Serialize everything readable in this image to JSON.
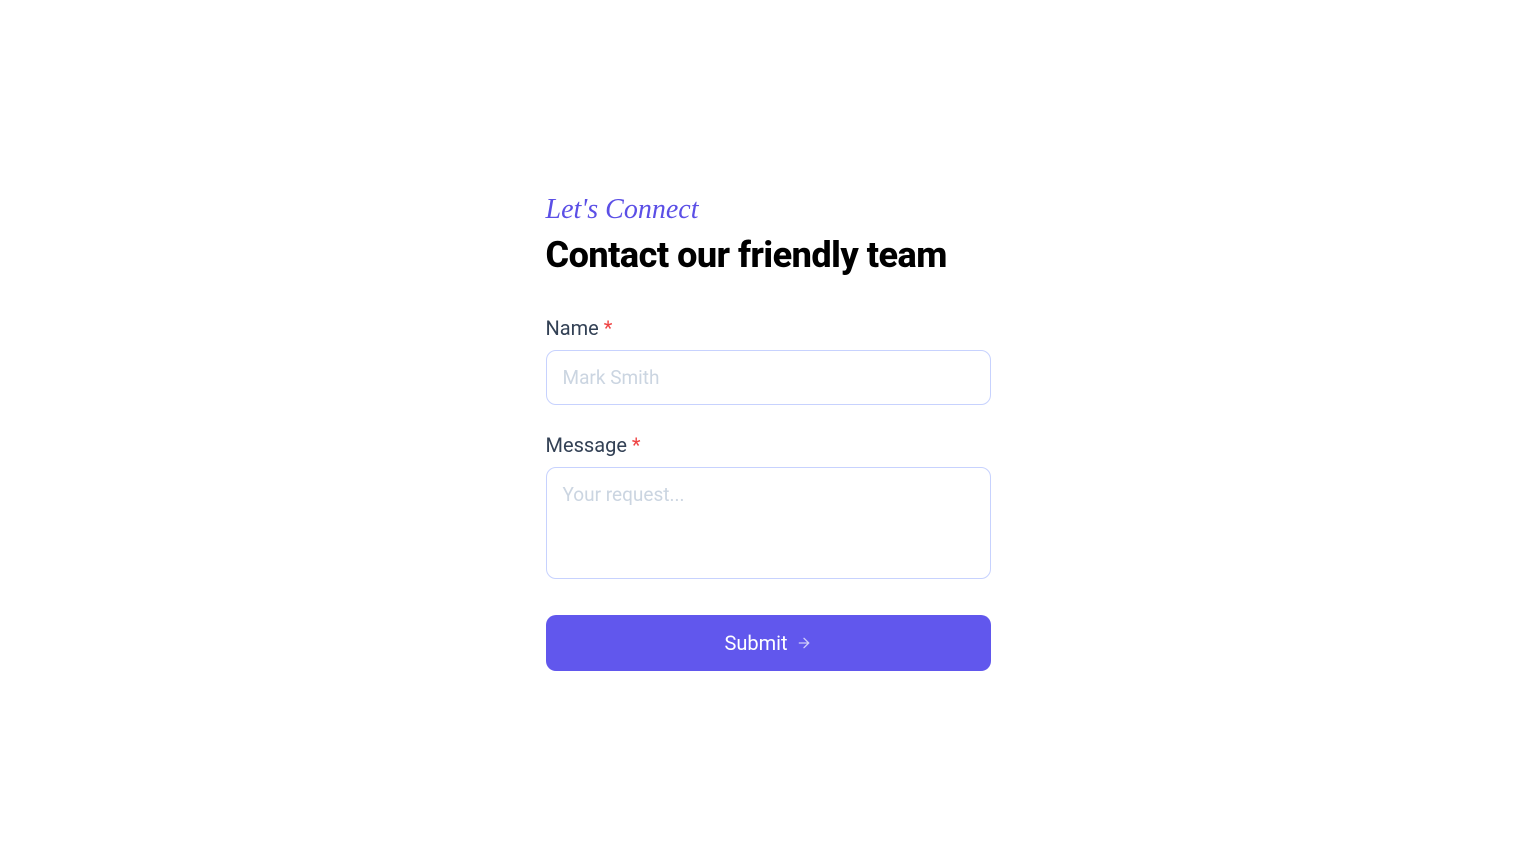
{
  "header": {
    "subtitle": "Let's Connect",
    "title": "Contact our friendly team"
  },
  "form": {
    "name": {
      "label": "Name ",
      "required": "*",
      "placeholder": "Mark Smith",
      "value": ""
    },
    "message": {
      "label": "Message ",
      "required": "*",
      "placeholder": "Your request...",
      "value": ""
    },
    "submit": {
      "label": "Submit"
    }
  },
  "colors": {
    "accent": "#6157ED",
    "subtitle": "#5B4FE6",
    "border": "#c7d2fe",
    "placeholder": "#cbd5e1",
    "text": "#334155",
    "required": "#ef4444"
  }
}
